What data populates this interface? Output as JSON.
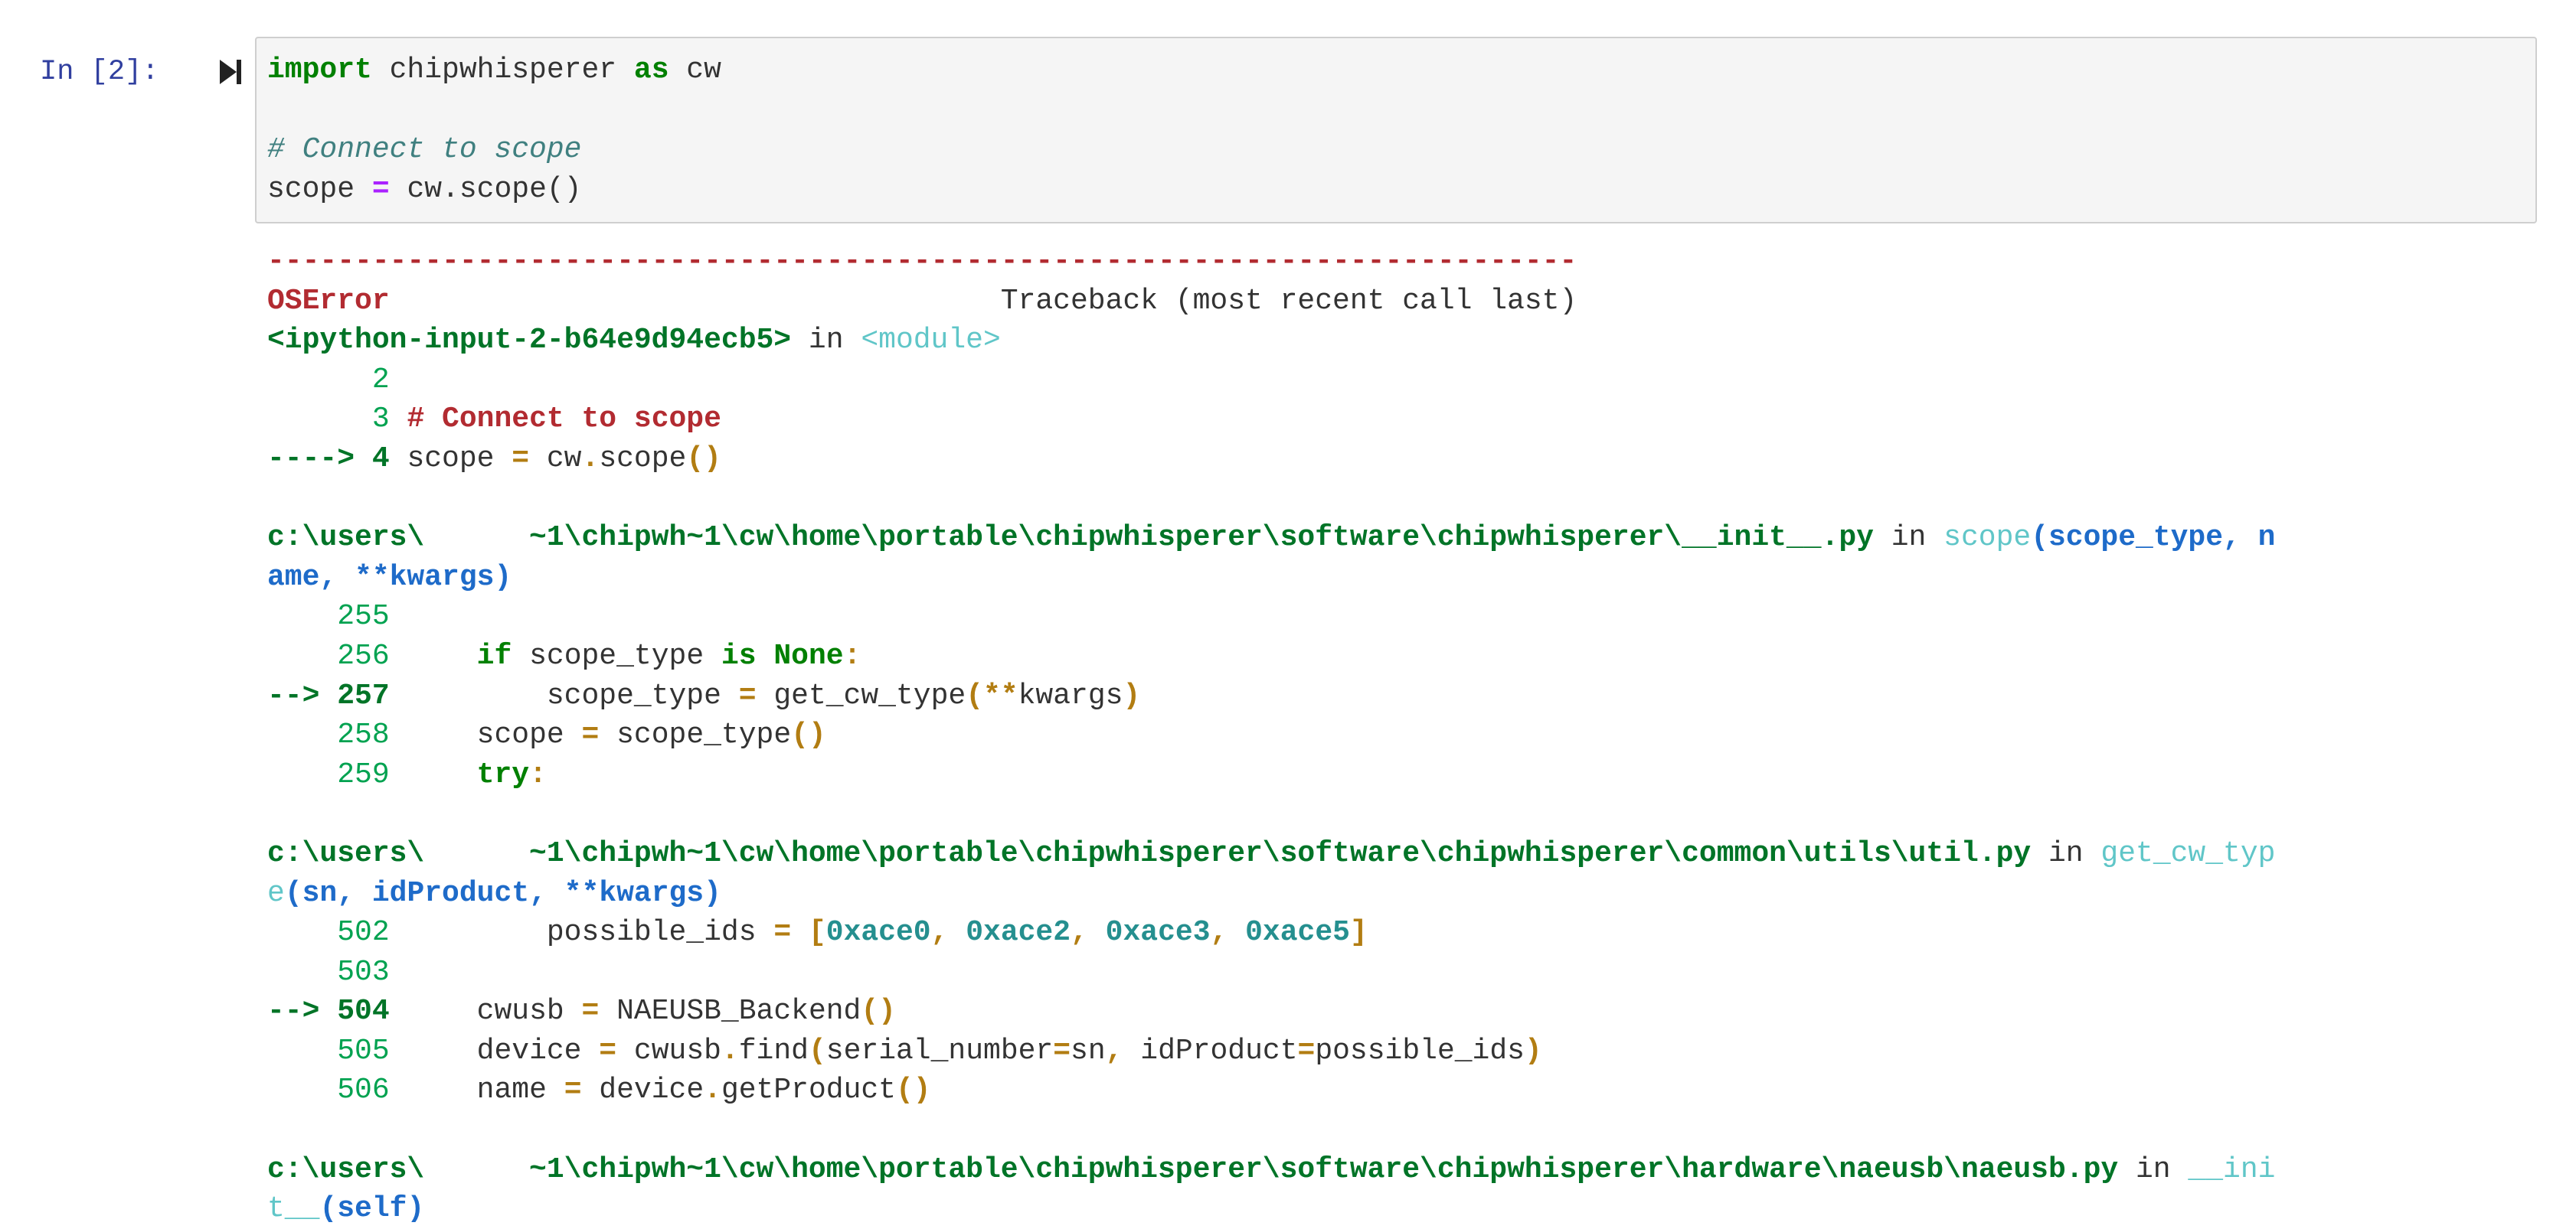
{
  "cell": {
    "prompt": "In [2]:",
    "code": {
      "l1_kw1": "import",
      "l1_mod": " chipwhisperer ",
      "l1_kw2": "as",
      "l1_alias": " cw",
      "l3_comment": "# Connect to scope",
      "l4_a": "scope ",
      "l4_op": "=",
      "l4_b": " cw.scope()"
    }
  },
  "traceback": {
    "separator": "---------------------------------------------------------------------------",
    "error_name": "OSError",
    "header_right": "                                   Traceback (most recent call last)",
    "frame1": {
      "file": "<ipython-input-2-b64e9d94ecb5>",
      "in_text": " in ",
      "func": "<module>",
      "l2_num": "      2",
      "l3_num": "      3 ",
      "l3_comment": "# Connect to scope",
      "l4_arrow": "----> 4 ",
      "l4_a": "scope ",
      "l4_op": "=",
      "l4_b": " cw",
      "l4_dot": ".",
      "l4_c": "scope",
      "l4_paren": "()"
    },
    "frame2": {
      "file_line1": "c:\\users\\      ~1\\chipwh~1\\cw\\home\\portable\\chipwhisperer\\software\\chipwhisperer\\__init__.py",
      "in_text": " in ",
      "func": "scope",
      "args_part1": "(scope_type, n",
      "args_part2": "ame, **kwargs)",
      "rows": [
        {
          "num": "    255",
          "code": ""
        },
        {
          "num": "    256",
          "code": "     if scope_type is None:"
        },
        {
          "num": "--> 257",
          "code": "         scope_type = get_cw_type(**kwargs)"
        },
        {
          "num": "    258",
          "code": "     scope = scope_type()"
        },
        {
          "num": "    259",
          "code": "     try:"
        }
      ]
    },
    "frame3": {
      "file_line1": "c:\\users\\      ~1\\chipwh~1\\cw\\home\\portable\\chipwhisperer\\software\\chipwhisperer\\common\\utils\\util.py",
      "in_text": " in ",
      "func_part1": "get_cw_typ",
      "func_part2": "e",
      "args": "(sn, idProduct, **kwargs)",
      "rows": [
        {
          "num": "    502",
          "code": "         possible_ids = [0xace0, 0xace2, 0xace3, 0xace5]"
        },
        {
          "num": "    503",
          "code": ""
        },
        {
          "num": "--> 504",
          "code": "     cwusb = NAEUSB_Backend()"
        },
        {
          "num": "    505",
          "code": "     device = cwusb.find(serial_number=sn, idProduct=possible_ids)"
        },
        {
          "num": "    506",
          "code": "     name = device.getProduct()"
        }
      ]
    },
    "frame4": {
      "file_line1": "c:\\users\\      ~1\\chipwh~1\\cw\\home\\portable\\chipwhisperer\\software\\chipwhisperer\\hardware\\naeusb\\naeusb.py",
      "in_text": " in ",
      "func_part1": "__ini",
      "func_part2": "t__",
      "args": "(self)"
    }
  },
  "colors": {
    "prompt": "#303f9f",
    "keyword": "#008000",
    "comment": "#408080",
    "error_red": "#b22b31",
    "traceback_green": "#007427",
    "func_cyan": "#60c6c8",
    "args_blue": "#1e6bc9",
    "lineno_green": "#00a250",
    "punct_yellow": "#b27d12"
  }
}
